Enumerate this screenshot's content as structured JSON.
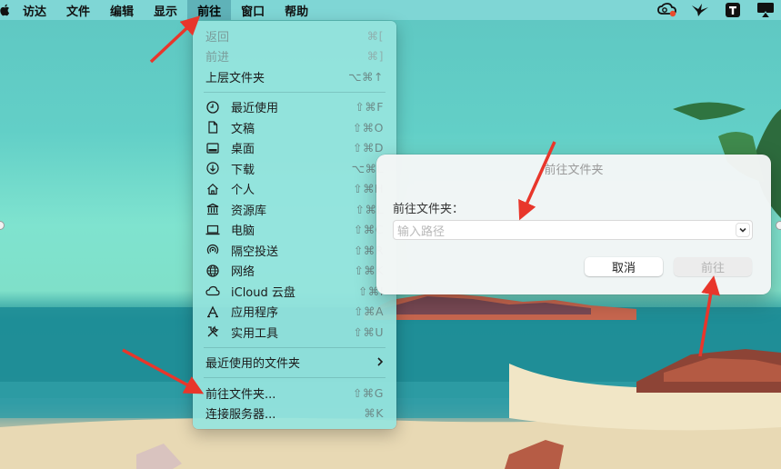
{
  "menubar": {
    "items": [
      {
        "label": "访达",
        "active": false
      },
      {
        "label": "文件",
        "active": false
      },
      {
        "label": "编辑",
        "active": false
      },
      {
        "label": "显示",
        "active": false
      },
      {
        "label": "前往",
        "active": true
      },
      {
        "label": "窗口",
        "active": false
      },
      {
        "label": "帮助",
        "active": false
      }
    ],
    "status_icons": [
      "creative-cloud-icon",
      "bird-icon",
      "typora-icon",
      "airplay-icon"
    ]
  },
  "go_menu": {
    "top_items": [
      {
        "label": "返回",
        "shortcut": "⌘[",
        "disabled": true
      },
      {
        "label": "前进",
        "shortcut": "⌘]",
        "disabled": true
      },
      {
        "label": "上层文件夹",
        "shortcut": "⌥⌘↑",
        "disabled": false
      }
    ],
    "places": [
      {
        "label": "最近使用",
        "shortcut": "⇧⌘F",
        "icon": "clock-icon"
      },
      {
        "label": "文稿",
        "shortcut": "⇧⌘O",
        "icon": "document-icon"
      },
      {
        "label": "桌面",
        "shortcut": "⇧⌘D",
        "icon": "desktop-icon"
      },
      {
        "label": "下载",
        "shortcut": "⌥⌘L",
        "icon": "download-icon"
      },
      {
        "label": "个人",
        "shortcut": "⇧⌘H",
        "icon": "home-icon"
      },
      {
        "label": "资源库",
        "shortcut": "⇧⌘L",
        "icon": "library-icon"
      },
      {
        "label": "电脑",
        "shortcut": "⇧⌘C",
        "icon": "laptop-icon"
      },
      {
        "label": "隔空投送",
        "shortcut": "⇧⌘R",
        "icon": "airdrop-icon"
      },
      {
        "label": "网络",
        "shortcut": "⇧⌘K",
        "icon": "network-icon"
      },
      {
        "label": "iCloud 云盘",
        "shortcut": "⇧⌘I",
        "icon": "cloud-icon"
      },
      {
        "label": "应用程序",
        "shortcut": "⇧⌘A",
        "icon": "applications-icon"
      },
      {
        "label": "实用工具",
        "shortcut": "⇧⌘U",
        "icon": "utilities-icon"
      }
    ],
    "recent_folders": {
      "label": "最近使用的文件夹"
    },
    "bottom_items": [
      {
        "label": "前往文件夹...",
        "shortcut": "⇧⌘G"
      },
      {
        "label": "连接服务器...",
        "shortcut": "⌘K"
      }
    ]
  },
  "dialog": {
    "title": "前往文件夹",
    "field_label": "前往文件夹：",
    "path_placeholder": "输入路径",
    "cancel_label": "取消",
    "go_label": "前往"
  },
  "colors": {
    "annotation_arrow": "#e8362b",
    "menu_bg": "#96e4de",
    "dialog_bg": "#f4f6f6"
  }
}
